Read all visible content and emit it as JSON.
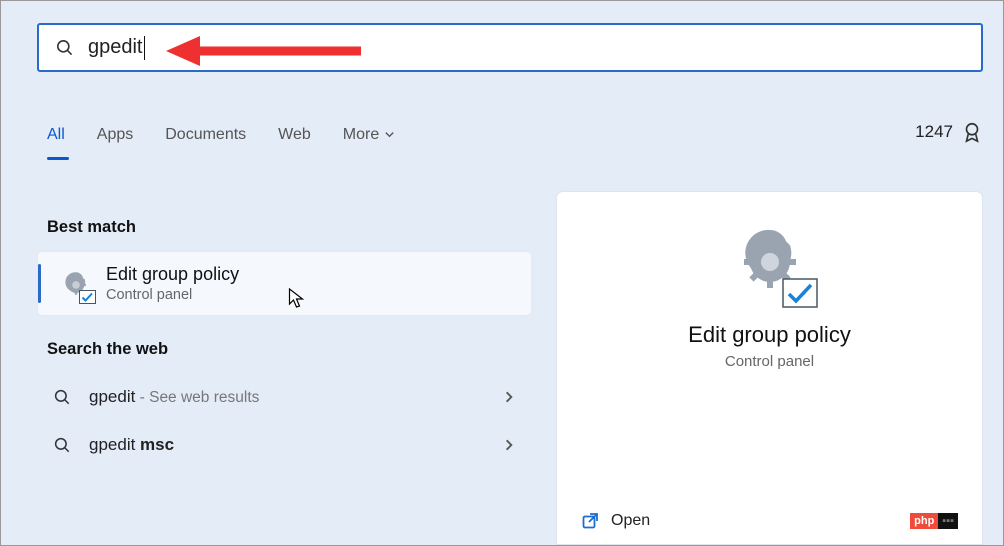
{
  "search": {
    "query": "gpedit"
  },
  "tabs": {
    "all": "All",
    "apps": "Apps",
    "documents": "Documents",
    "web": "Web",
    "more": "More"
  },
  "rewards": {
    "points": "1247"
  },
  "left": {
    "best_match_heading": "Best match",
    "best": {
      "title": "Edit group policy",
      "subtitle": "Control panel"
    },
    "search_web_heading": "Search the web",
    "web_items": [
      {
        "term": "gpedit",
        "hint": " - See web results"
      },
      {
        "term_pre": "gpedit ",
        "term_bold": "msc"
      }
    ]
  },
  "right": {
    "title": "Edit group policy",
    "subtitle": "Control panel",
    "open_label": "Open"
  },
  "watermark": {
    "text": "php"
  }
}
